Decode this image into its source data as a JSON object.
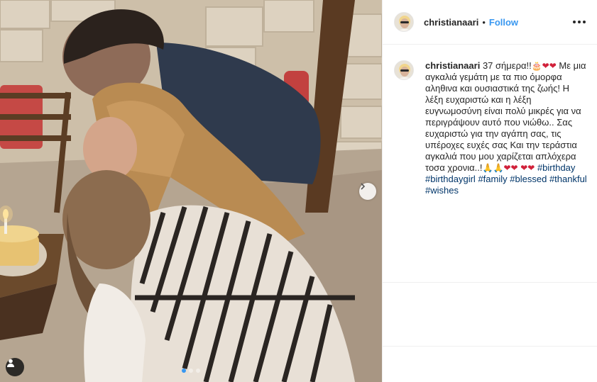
{
  "post": {
    "username": "christianaari",
    "separator": "•",
    "follow_label": "Follow",
    "caption_text": "37 σήμερα!!",
    "caption_body": "Με μια αγκαλιά γεμάτη με τα πιο όμορφα αληθινα και ουσιαστικά της ζωής! Η λέξη ευχαριστώ και η λέξη ευγνωμοσύνη είναι πολύ μικρές για να περιγράψουν αυτό που νιώθω.. Σας ευχαριστώ για την αγάπη σας, τις υπέροχες ευχές σας Και την τεράστια αγκαλιά που μου χαρίζεται απλόχερα τοσα χρονια..!",
    "emoji_cake": "🎂",
    "emoji_heart": "❤",
    "emoji_pray": "🙏",
    "hashtags": [
      "#birthday",
      "#birthdaygirl",
      "#family",
      "#blessed",
      "#thankful",
      "#wishes"
    ]
  },
  "carousel": {
    "total_slides": 3,
    "active_slide": 1
  },
  "colors": {
    "accent": "#3897f0",
    "hashtag": "#003569",
    "text": "#262626",
    "border": "#efefef"
  },
  "icons": [
    "chevron-right-icon",
    "user-tag-icon",
    "more-options-icon"
  ]
}
